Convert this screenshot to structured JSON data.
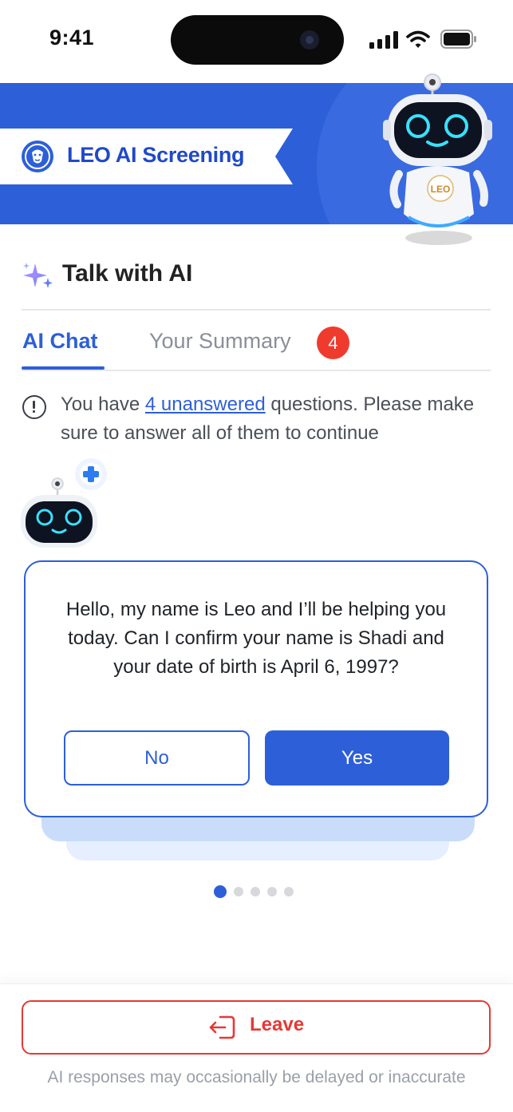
{
  "status_bar": {
    "time": "9:41"
  },
  "banner": {
    "title": "LEO AI Screening",
    "robot_badge": "LEO"
  },
  "section": {
    "title": "Talk with AI"
  },
  "tabs": [
    {
      "label": "AI Chat",
      "active": true
    },
    {
      "label": "Your Summary",
      "active": false,
      "badge": "4"
    }
  ],
  "notice": {
    "prefix": "You have ",
    "link": "4 unanswered",
    "suffix": " questions. Please make sure to answer all of them to continue"
  },
  "chat": {
    "message": "Hello, my name is Leo and I’ll be helping you today. Can I confirm your name is Shadi and your date of birth is April 6, 1997?",
    "no_label": "No",
    "yes_label": "Yes"
  },
  "pager": {
    "count": 5,
    "active_index": 0
  },
  "footer": {
    "leave_label": "Leave",
    "disclaimer": "AI responses may occasionally be delayed or inaccurate"
  },
  "colors": {
    "primary": "#2d5fd8",
    "danger": "#e53935",
    "badge": "#ef3b2d"
  }
}
